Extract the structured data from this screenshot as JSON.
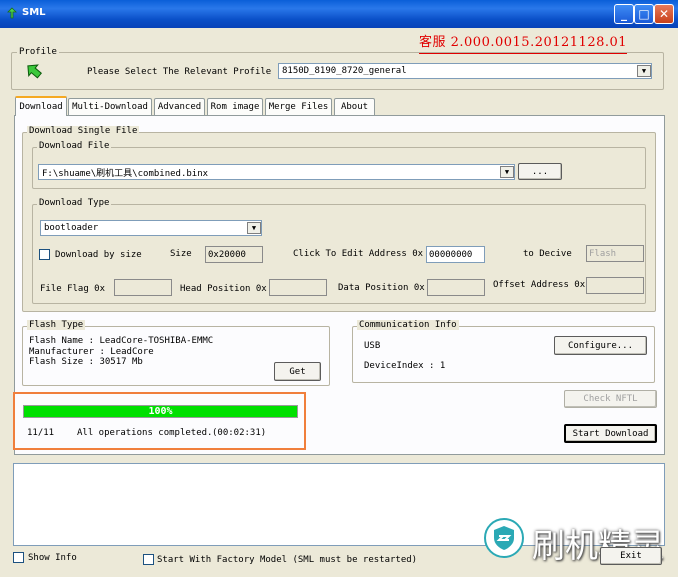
{
  "window": {
    "title": "SML",
    "version_text": "客服 2.000.0015.20121128.01"
  },
  "profile": {
    "group_title": "Profile",
    "prompt": "Please Select The Relevant Profile",
    "selected": "8150D_8190_8720_general"
  },
  "tabs": [
    {
      "label": "Download",
      "active": true
    },
    {
      "label": "Multi-Download"
    },
    {
      "label": "Advanced"
    },
    {
      "label": "Rom image"
    },
    {
      "label": "Merge Files"
    },
    {
      "label": "About"
    }
  ],
  "single_file": {
    "group_title": "Download Single File",
    "file_group_title": "Download File",
    "file_path": "F:\\shuame\\刷机工具\\combined.binx",
    "browse_label": "...",
    "type_group_title": "Download Type",
    "type_selected": "bootloader",
    "by_size_label": "Download by size",
    "size_label": "Size",
    "size_value": "0x20000",
    "click_edit_label": "Click To Edit Address 0x",
    "address_value": "00000000",
    "to_device_label": "to Decive",
    "to_device_value": "Flash",
    "file_flag_label": "File Flag 0x",
    "head_position_label": "Head Position 0x",
    "data_position_label": "Data Position 0x",
    "offset_address_label": "Offset Address 0x"
  },
  "flash_type": {
    "group_title": "Flash Type",
    "name_line": "Flash Name : LeadCore-TOSHIBA-EMMC",
    "manufacturer_line": "Manufacturer : LeadCore",
    "size_line": "Flash Size : 30517 Mb",
    "get_label": "Get"
  },
  "comm_info": {
    "group_title": "Communication Info",
    "port": "USB",
    "configure_label": "Configure...",
    "device_index_line": "DeviceIndex : 1"
  },
  "progress": {
    "percent_text": "100%",
    "fraction": 1.0,
    "count": "11/11",
    "status": "All operations completed.",
    "elapsed": "(00:02:31)",
    "bar_color": "#00e000",
    "highlight_color": "#f07f3c"
  },
  "buttons": {
    "check_nftl": "Check NFTL",
    "start_download": "Start Download",
    "exit": "Exit"
  },
  "footer": {
    "show_info": "Show Info",
    "factory_model": "Start With Factory Model  (SML must be restarted)"
  },
  "watermark": {
    "text": "刷机精灵"
  }
}
